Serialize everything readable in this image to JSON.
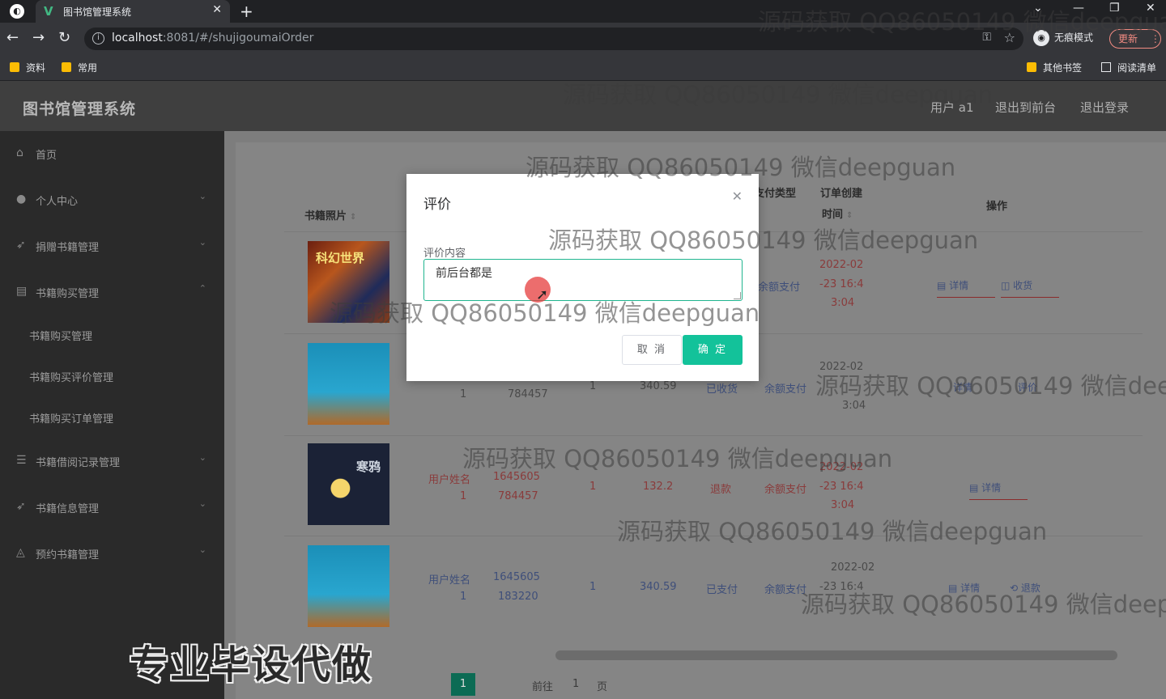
{
  "browser": {
    "tab_title": "图书馆管理系统",
    "url_host": "localhost",
    "url_rest": ":8081/#/shujigoumaiOrder",
    "incognito_label": "无痕模式",
    "update_label": "更新",
    "bookmarks": [
      "资料",
      "常用"
    ],
    "other_bookmarks": "其他书签",
    "reading_list": "阅读清单"
  },
  "app": {
    "title": "图书馆管理系统",
    "user_label": "用户 a1",
    "back_to_front": "退出到前台",
    "logout": "退出登录"
  },
  "sidebar": {
    "items": [
      {
        "label": "首页"
      },
      {
        "label": "个人中心"
      },
      {
        "label": "捐赠书籍管理"
      },
      {
        "label": "书籍购买管理"
      },
      {
        "label": "书籍借阅记录管理"
      },
      {
        "label": "书籍信息管理"
      },
      {
        "label": "预约书籍管理"
      }
    ],
    "sub_items": [
      "书籍购买管理",
      "书籍购买评价管理",
      "书籍购买订单管理"
    ]
  },
  "table": {
    "headers": {
      "cover": "书籍照片",
      "pay_type": "支付类型",
      "created_line1": "订单创建",
      "created_line2": "时间",
      "ops": "操作"
    },
    "rows": [
      {
        "cover_title": "科幻世界",
        "username": "",
        "account1": "",
        "account2": "",
        "qty": "",
        "price": "",
        "status": "",
        "pay": "余额支付",
        "date1": "2022-02",
        "date2": "-23 16:4",
        "date3": "3:04",
        "op1": "详情",
        "op2": "收货"
      },
      {
        "cover_title": "",
        "username": "",
        "account1": "1",
        "account2": "784457",
        "qty": "1",
        "price": "340.59",
        "status": "已收货",
        "pay": "余额支付",
        "date1": "2022-02",
        "date2": "",
        "date3": "3:04",
        "op1": "详情",
        "op2": "评价"
      },
      {
        "cover_title": "寒鸦",
        "username": "用户姓名",
        "account1": "1645605",
        "account2": "784457",
        "qty": "1",
        "price": "132.2",
        "status": "退款",
        "pay": "余额支付",
        "date1": "2022-02",
        "date2": "-23 16:4",
        "date3": "3:04",
        "op1": "详情",
        "op2": ""
      },
      {
        "cover_title": "",
        "username": "用户姓名",
        "account1": "1645605",
        "account2": "183220",
        "qty": "1",
        "price": "340.59",
        "status": "已支付",
        "pay": "余额支付",
        "date1": "2022-02",
        "date2": "-23 16:4",
        "date3": "",
        "op1": "详情",
        "op2": "退款"
      }
    ],
    "user_suffix": "1"
  },
  "pagination": {
    "current": "1",
    "goto_label": "前往",
    "goto_value": "1",
    "page_suffix": "页"
  },
  "dialog": {
    "title": "评价",
    "field_label": "评价内容",
    "content": "前后台都是",
    "cancel_label": "取 消",
    "ok_label": "确 定"
  },
  "watermark": "源码获取 QQ86050149 微信deepguan",
  "promo_text": "专业毕设代做",
  "colors": {
    "primary": "#13c29a",
    "sidebar_bg": "#2a2a2a",
    "header_bg": "#3f3f3f",
    "pager_active": "#0c6b54"
  }
}
